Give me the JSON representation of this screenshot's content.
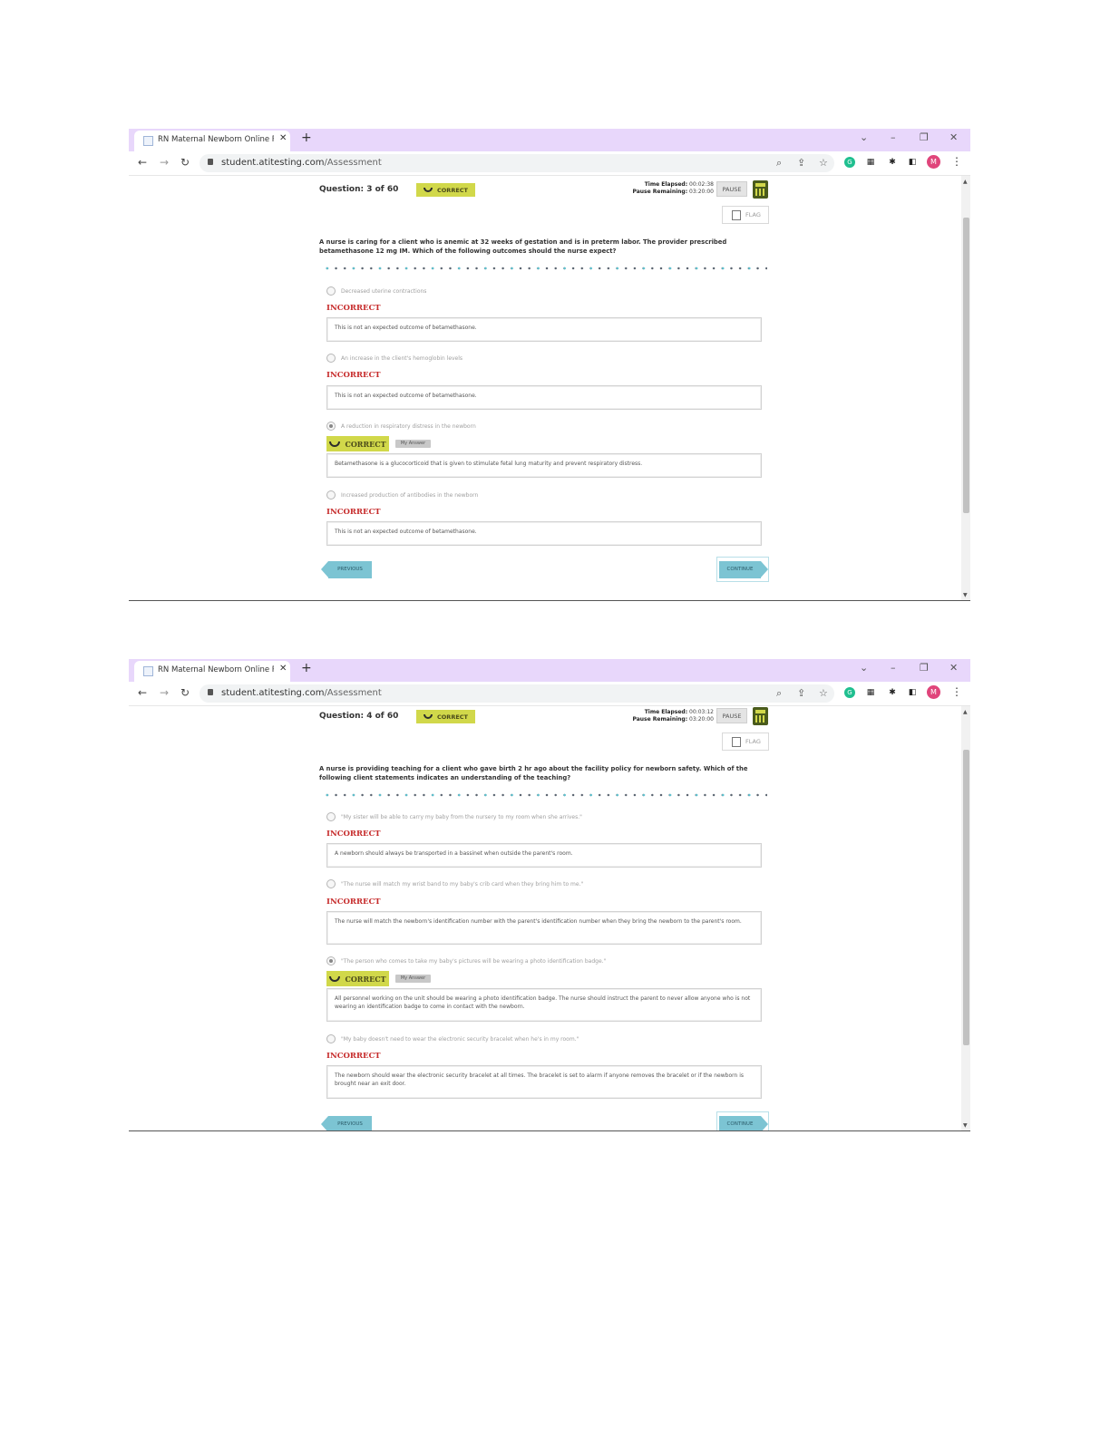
{
  "screenshots": [
    {
      "browser": {
        "tab_title": "RN Maternal Newborn Online Pr",
        "url_host": "student.atitesting.com",
        "url_path": "/Assessment",
        "avatar_initial": "M"
      },
      "question": {
        "counter": "Question: 3 of 60",
        "status_badge": "CORRECT",
        "time_elapsed_label": "Time Elapsed:",
        "time_elapsed": "00:02:38",
        "pause_remaining_label": "Pause Remaining:",
        "pause_remaining": "03:20:00",
        "pause_label": "PAUSE",
        "flag_label": "FLAG",
        "stem": "A nurse is caring for a client who is anemic at 32 weeks of gestation and is in preterm labor. The provider prescribed betamethasone 12 mg IM. Which of the following outcomes should the nurse expect?",
        "options": [
          {
            "text": "Decreased uterine contractions",
            "result": "INCORRECT",
            "rationale": "This is not an expected outcome of betamethasone."
          },
          {
            "text": "An increase in the client's hemoglobin levels",
            "result": "INCORRECT",
            "rationale": "This is not an expected outcome of betamethasone."
          },
          {
            "text": "A reduction in respiratory distress in the newborn",
            "result": "CORRECT",
            "my_answer": "My Answer",
            "rationale": "Betamethasone is a glucocorticoid that is given to stimulate fetal lung maturity and prevent respiratory distress."
          },
          {
            "text": "Increased production of antibodies in the newborn",
            "result": "INCORRECT",
            "rationale": "This is not an expected outcome of betamethasone."
          }
        ],
        "previous_label": "PREVIOUS",
        "continue_label": "CONTINUE"
      }
    },
    {
      "browser": {
        "tab_title": "RN Maternal Newborn Online Pr",
        "url_host": "student.atitesting.com",
        "url_path": "/Assessment",
        "avatar_initial": "M"
      },
      "question": {
        "counter": "Question: 4 of 60",
        "status_badge": "CORRECT",
        "time_elapsed_label": "Time Elapsed:",
        "time_elapsed": "00:03:12",
        "pause_remaining_label": "Pause Remaining:",
        "pause_remaining": "03:20:00",
        "pause_label": "PAUSE",
        "flag_label": "FLAG",
        "stem": "A nurse is providing teaching for a client who gave birth 2 hr ago about the facility policy for newborn safety. Which of the following client statements indicates an understanding of the teaching?",
        "options": [
          {
            "text": "\"My sister will be able to carry my baby from the nursery to my room when she arrives.\"",
            "result": "INCORRECT",
            "rationale": "A newborn should always be transported in a bassinet when outside the parent's room."
          },
          {
            "text": "\"The nurse will match my wrist band to my baby's crib card when they bring him to me.\"",
            "result": "INCORRECT",
            "rationale": "The nurse will match the newborn's identification number with the parent's identification number when they bring the newborn to the parent's room."
          },
          {
            "text": "\"The person who comes to take my baby's pictures will be wearing a photo identification badge.\"",
            "result": "CORRECT",
            "my_answer": "My Answer",
            "rationale": "All personnel working on the unit should be wearing a photo identification badge. The nurse should instruct the parent to never allow anyone who is not wearing an identification badge to come in contact with the newborn."
          },
          {
            "text": "\"My baby doesn't need to wear the electronic security bracelet when he's in my room.\"",
            "result": "INCORRECT",
            "rationale": "The newborn should wear the electronic security bracelet at all times. The bracelet is set to alarm if anyone removes the bracelet or if the newborn is brought near an exit door."
          }
        ],
        "previous_label": "PREVIOUS",
        "continue_label": "CONTINUE"
      }
    }
  ]
}
